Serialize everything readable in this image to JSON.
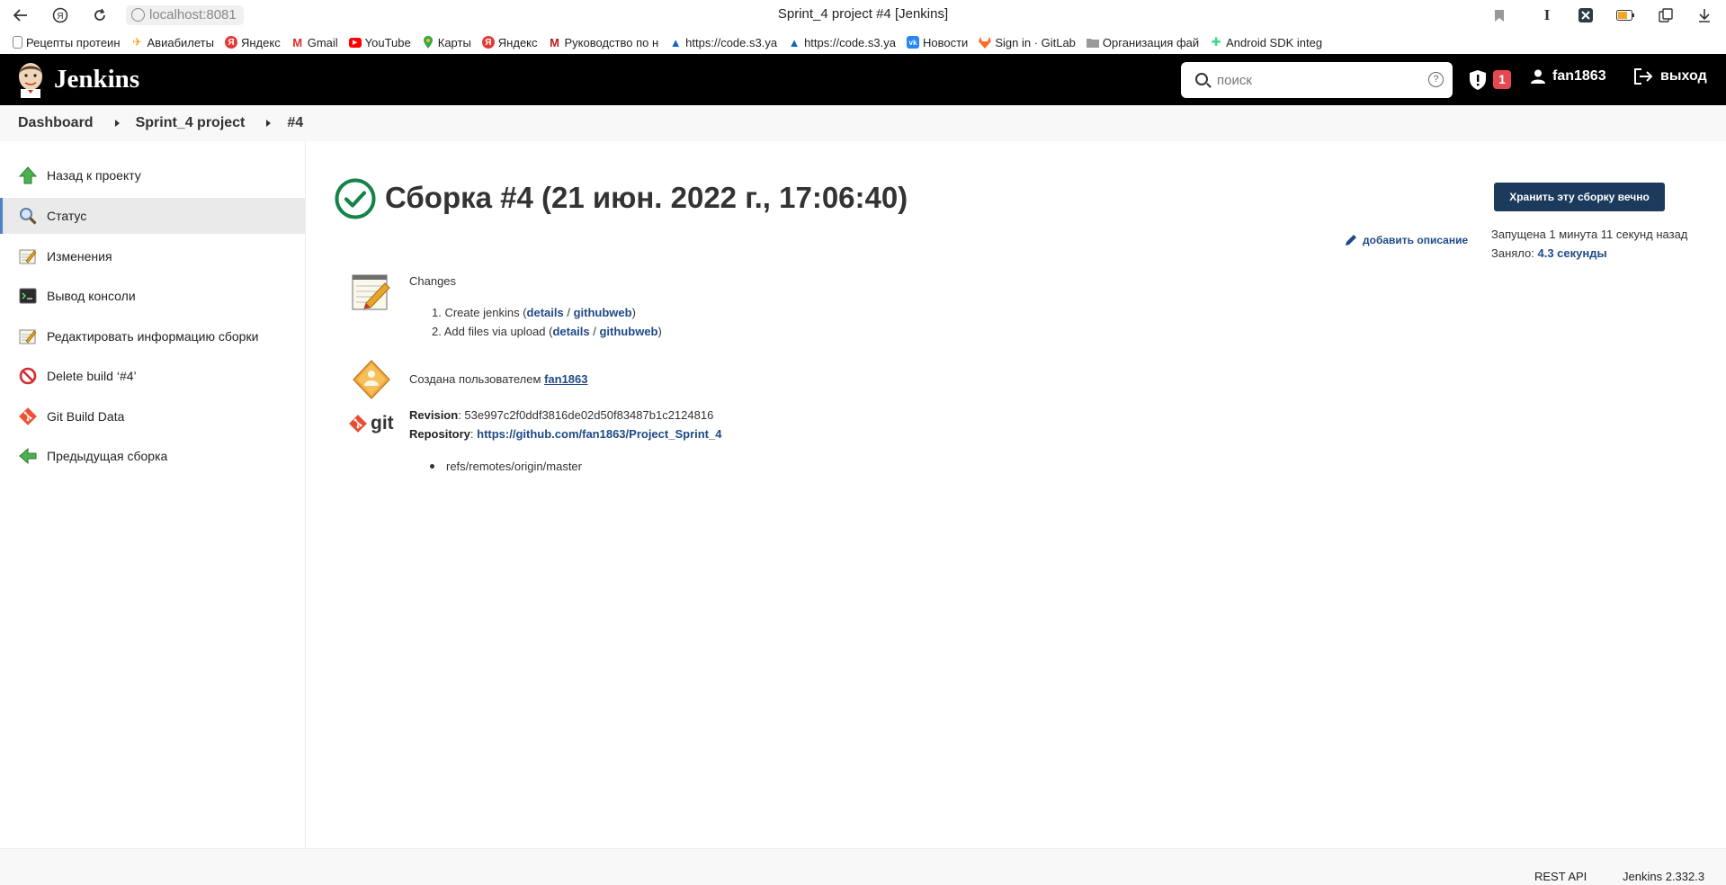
{
  "browser": {
    "address": "localhost:8081",
    "window_title": "Sprint_4 project #4 [Jenkins]",
    "bookmarks": [
      {
        "label": "Рецепты протеин",
        "color": "#888888",
        "glyph": "doc"
      },
      {
        "label": "Авиабилеты",
        "color": "#f5a623",
        "glyph": "plane"
      },
      {
        "label": "Яндекс",
        "color": "#e53935",
        "glyph": "Я"
      },
      {
        "label": "Gmail",
        "color": "#d93025",
        "glyph": "M"
      },
      {
        "label": "YouTube",
        "color": "#ff0000",
        "glyph": "▶"
      },
      {
        "label": "Карты",
        "color": "#34a853",
        "glyph": "pin"
      },
      {
        "label": "Яндекс",
        "color": "#e53935",
        "glyph": "Я"
      },
      {
        "label": "Руководство по н",
        "color": "#b71c1c",
        "glyph": "M"
      },
      {
        "label": "https://code.s3.ya",
        "color": "#1565c0",
        "glyph": "▲"
      },
      {
        "label": "https://code.s3.ya",
        "color": "#1565c0",
        "glyph": "▲"
      },
      {
        "label": "Новости",
        "color": "#2787f5",
        "glyph": "vk"
      },
      {
        "label": "Sign in · GitLab",
        "color": "#fc6d26",
        "glyph": "fox"
      },
      {
        "label": "Организация фай",
        "color": "#777777",
        "glyph": "folder"
      },
      {
        "label": "Android SDK integ",
        "color": "#3ddc84",
        "glyph": "puzzle"
      }
    ]
  },
  "header": {
    "logo": "Jenkins",
    "search_placeholder": "поиск",
    "alerts_count": "1",
    "username": "fan1863",
    "logout": "выход"
  },
  "breadcrumb": [
    "Dashboard",
    "Sprint_4 project",
    "#4"
  ],
  "sidebar": {
    "items": [
      {
        "label": "Назад к проекту",
        "icon": "up-arrow-icon"
      },
      {
        "label": "Статус",
        "icon": "search-icon"
      },
      {
        "label": "Изменения",
        "icon": "notepad-icon"
      },
      {
        "label": "Вывод консоли",
        "icon": "terminal-icon"
      },
      {
        "label": "Редактировать информацию сборки",
        "icon": "notepad-icon"
      },
      {
        "label": "Delete build ‘#4’",
        "icon": "no-entry-icon"
      },
      {
        "label": "Git Build Data",
        "icon": "git-icon"
      },
      {
        "label": "Предыдущая сборка",
        "icon": "left-arrow-icon"
      }
    ]
  },
  "main": {
    "title": "Сборка #4 (21 июн. 2022 г., 17:06:40)",
    "keep_button": "Хранить эту сборку вечно",
    "add_description": "добавить описание",
    "started": "Запущена 1 минута 11 секунд назад",
    "took_label": "Заняло:",
    "took_value": "4.3 секунды",
    "changes_heading": "Changes",
    "changes": [
      {
        "num": "1.",
        "text": "Create jenkins",
        "details": "details",
        "web": "githubweb"
      },
      {
        "num": "2.",
        "text": "Add files via upload",
        "details": "details",
        "web": "githubweb"
      }
    ],
    "cause_text": "Создана пользователем",
    "cause_user": "fan1863",
    "git_label": "git",
    "revision_label": "Revision",
    "revision": "53e997c2f0ddf3816de02d50f83487b1c2124816",
    "repository_label": "Repository",
    "repository": "https://github.com/fan1863/Project_Sprint_4",
    "refs": "refs/remotes/origin/master"
  },
  "footer": {
    "rest_api": "REST API",
    "version": "Jenkins 2.332.3"
  }
}
